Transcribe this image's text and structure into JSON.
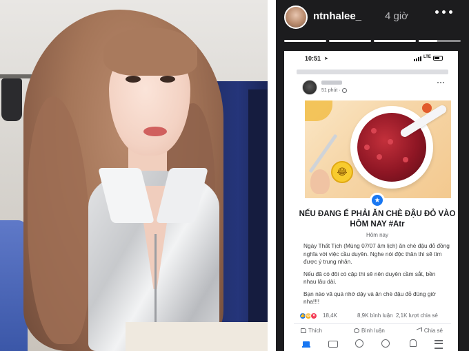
{
  "story": {
    "username": "ntnhalee_",
    "time": "4 giờ",
    "progress": 0.45
  },
  "phone": {
    "status_time": "10:51",
    "network": "LTE"
  },
  "post": {
    "meta_time": "51 phút",
    "title": "NẾU ĐANG Ế PHẢI ĂN CHÈ ĐẬU ĐỎ VÀO HÔM NAY #Atr",
    "date": "Hôm nay",
    "paragraphs": [
      "Ngày Thất Tịch (Mùng 07/07 âm lịch) ăn chè đậu đỏ đồng nghĩa với việc cầu duyên. Nghe nói độc thân thì sẽ tìm được ý trung nhân.",
      "Nếu đã có đôi có cặp thì sẽ nên duyên cầm sắt, bền nhau lâu dài.",
      "Bạn nào vã quá nhớ dậy và ăn chè đậu đỏ đúng giờ nha!!!!"
    ],
    "reaction_count": "18,4K",
    "comment_count": "8,9K bình luận",
    "share_count": "2,1K lượt chia sẻ",
    "actions": {
      "like": "Thích",
      "comment": "Bình luận",
      "share": "Chia sẻ"
    }
  },
  "icons": {
    "emoji": "laughing-emoji",
    "badge": "star-badge"
  }
}
